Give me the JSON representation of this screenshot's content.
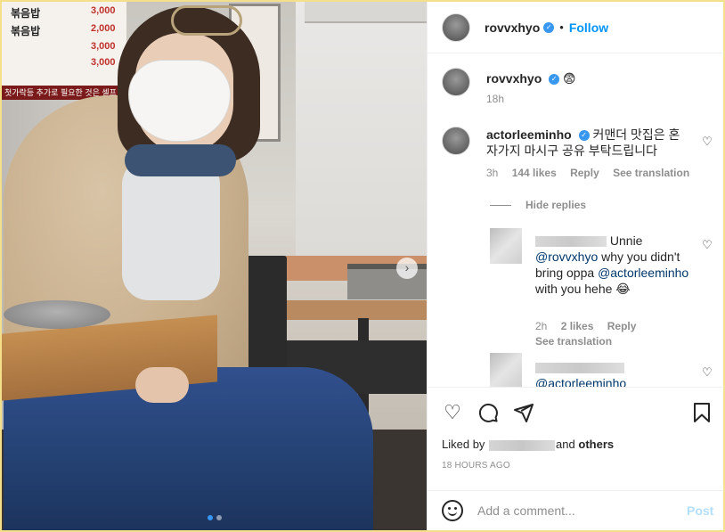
{
  "photo": {
    "menu_items": [
      {
        "name": "볶음밥",
        "price": "3,000"
      },
      {
        "name": "볶음밥",
        "price": "2,000"
      },
      {
        "name": "",
        "price": "3,000"
      },
      {
        "name": "",
        "price": "3,000"
      }
    ],
    "menu_banner": "첫가락등 추가로 필요한 것은 셀프",
    "next_label": "›",
    "slides": 2,
    "active_slide": 1
  },
  "header": {
    "username": "rovvxhyo",
    "separator": "•",
    "follow_label": "Follow"
  },
  "caption": {
    "username": "rovvxhyo",
    "emoji": "😨",
    "time": "18h"
  },
  "comments": [
    {
      "username": "actorleeminho",
      "text": "커맨더 맛집은 혼자가지 마시구 공유 부탁드립니다",
      "time": "3h",
      "likes": "144 likes",
      "reply_label": "Reply",
      "translate_label": "See translation"
    }
  ],
  "hide_replies_label": "Hide replies",
  "replies": [
    {
      "text_before": "Unnie",
      "mention1": "@rovvxhyo",
      "text_mid": "why you didn't bring oppa",
      "mention2": "@actorleeminho",
      "text_after": "with you hehe 😂",
      "time": "2h",
      "likes": "2 likes",
      "reply_label": "Reply",
      "translate_label": "See translation"
    },
    {
      "mention1": "@actorleeminho"
    }
  ],
  "actions": {
    "liked_prefix": "Liked by",
    "liked_suffix_and": "and",
    "liked_others": "others",
    "time_ago": "18 HOURS AGO"
  },
  "add_comment": {
    "placeholder": "Add a comment...",
    "post_label": "Post"
  },
  "colors": {
    "accent": "#0095f6",
    "verified": "#3897f0",
    "muted": "#8e8e8e",
    "post_disabled": "#b2dffc"
  }
}
